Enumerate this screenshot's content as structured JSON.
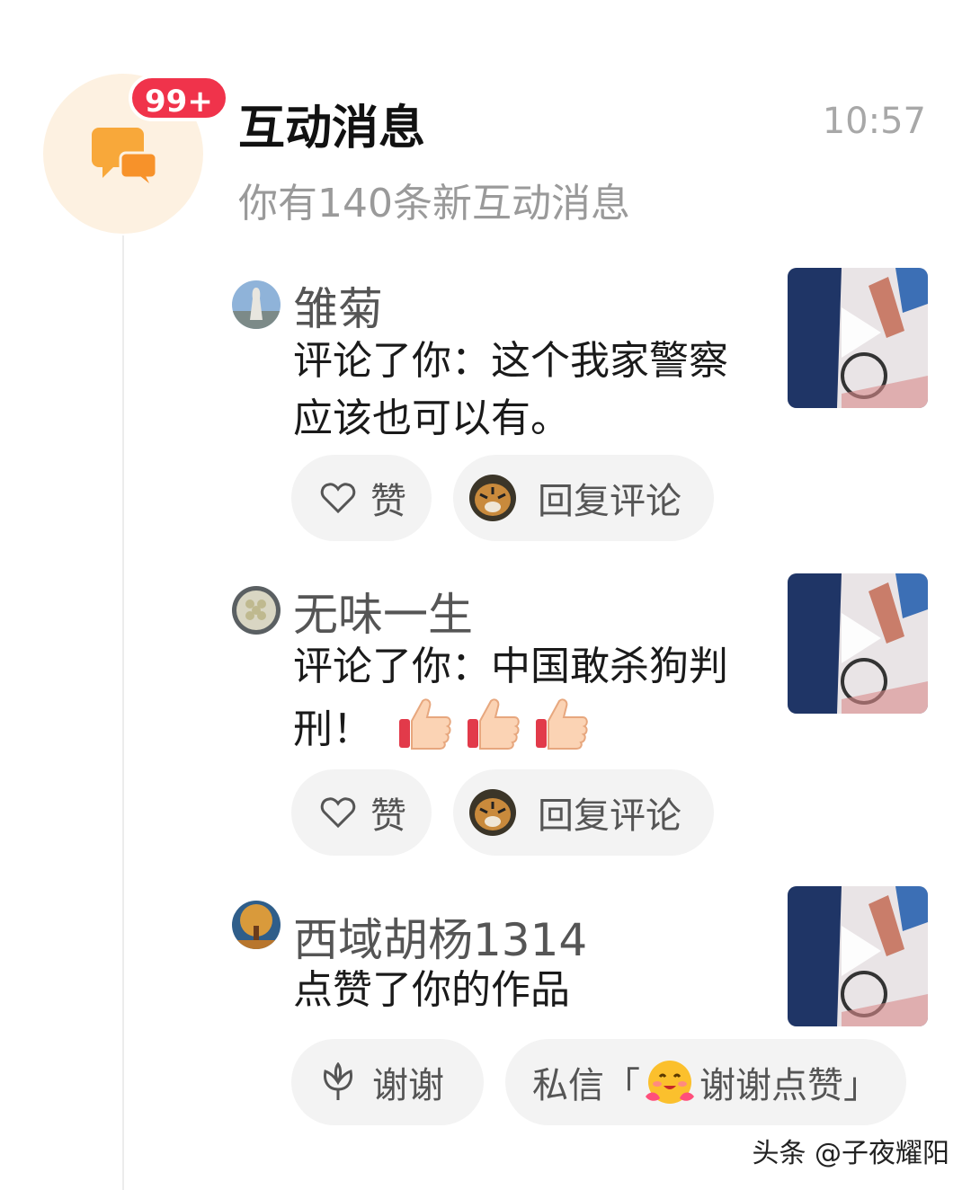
{
  "header": {
    "title": "互动消息",
    "time": "10:57",
    "subtitle": "你有140条新互动消息",
    "badge": "99+",
    "icon": "chat-bubbles-icon"
  },
  "messages": [
    {
      "name": "雏菊",
      "text": "评论了你：这个我家警察应该也可以有。",
      "like_label": "赞",
      "reply_label": "回复评论"
    },
    {
      "name": "无味一生",
      "text": "评论了你：中国敢杀狗判刑！",
      "like_label": "赞",
      "reply_label": "回复评论",
      "emojis": [
        "thumbs-up",
        "thumbs-up",
        "thumbs-up"
      ]
    },
    {
      "name": "西域胡杨1314",
      "text": "点赞了你的作品",
      "thanks_label": "谢谢",
      "dm_prefix": "私信「",
      "dm_text": "谢谢点赞」"
    }
  ],
  "watermark": "头条 @子夜耀阳",
  "colors": {
    "badge": "#f0334b",
    "header_avatar_bg": "#fdf1e1",
    "chat_icon": "#f8a83a",
    "pill_bg": "#f3f3f3"
  }
}
